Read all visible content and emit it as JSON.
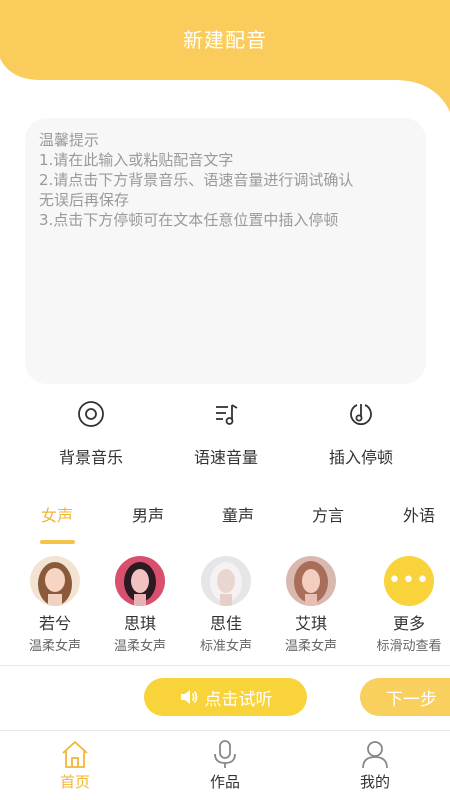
{
  "header": {
    "title": "新建配音"
  },
  "editor": {
    "tips": [
      "温馨提示",
      "1.请在此输入或粘贴配音文字",
      "2.请点击下方背景音乐、语速音量进行调试确认",
      "无误后再保存",
      "3.点击下方停顿可在文本任意位置中插入停顿"
    ]
  },
  "tools": [
    {
      "label": "背景音乐",
      "icon": "disc-icon"
    },
    {
      "label": "语速音量",
      "icon": "music-list-icon"
    },
    {
      "label": "插入停顿",
      "icon": "pause-note-icon"
    }
  ],
  "tabs": [
    "女声",
    "男声",
    "童声",
    "方言",
    "外语"
  ],
  "active_tab": "女声",
  "voices": [
    {
      "name": "若兮",
      "desc": "温柔女声"
    },
    {
      "name": "思琪",
      "desc": "温柔女声"
    },
    {
      "name": "思佳",
      "desc": "标准女声"
    },
    {
      "name": "艾琪",
      "desc": "温柔女声"
    },
    {
      "name": "更多",
      "desc": "标滑动查看"
    }
  ],
  "actions": {
    "preview": "点击试听",
    "next": "下一步"
  },
  "nav": [
    {
      "label": "首页",
      "icon": "home-icon"
    },
    {
      "label": "作品",
      "icon": "microphone-icon"
    },
    {
      "label": "我的",
      "icon": "user-icon"
    }
  ],
  "colors": {
    "accent": "#f9d33a",
    "header": "#f9cc5c",
    "active_text": "#f2b632"
  }
}
